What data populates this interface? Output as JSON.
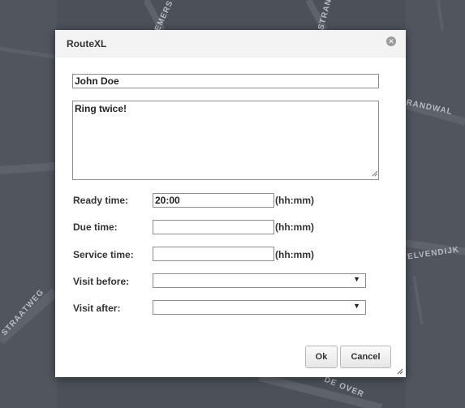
{
  "map": {
    "labels": [
      "EMERS",
      "STRAN",
      "RANDWAL",
      "ELVENDIJK",
      "STRAATWEG",
      "DE OVER"
    ]
  },
  "dialog": {
    "title": "RouteXL",
    "close_icon": "close-icon",
    "name_value": "John Doe",
    "notes_value": "Ring twice!",
    "fields": {
      "ready_label": "Ready time:",
      "ready_value": "20:00",
      "ready_hint": "(hh:mm)",
      "due_label": "Due time:",
      "due_value": "",
      "due_hint": "(hh:mm)",
      "service_label": "Service time:",
      "service_value": "",
      "service_hint": "(hh:mm)",
      "before_label": "Visit before:",
      "before_value": "",
      "after_label": "Visit after:",
      "after_value": ""
    },
    "buttons": {
      "ok_label": "Ok",
      "cancel_label": "Cancel"
    }
  },
  "colors": {
    "map_background": "#4b5059",
    "titlebar": "#f3f3f3",
    "dialog_background": "#ffffff"
  }
}
